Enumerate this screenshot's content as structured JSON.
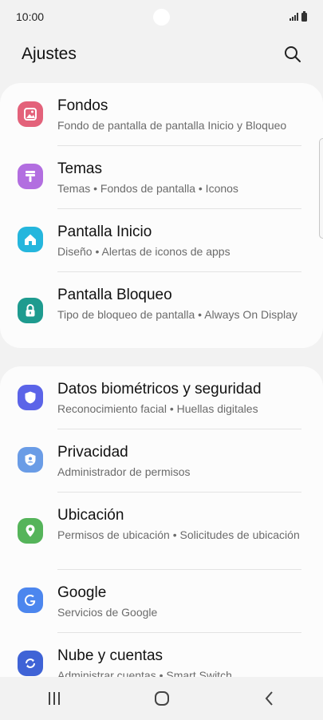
{
  "status_bar": {
    "time": "10:00"
  },
  "header": {
    "title": "Ajustes"
  },
  "group1": [
    {
      "title": "Fondos",
      "subtitle": "Fondo de pantalla de pantalla Inicio y Bloqueo",
      "icon": "wallpaper-icon",
      "color": "#e3627a"
    },
    {
      "title": "Temas",
      "subtitle": "Temas  •  Fondos de pantalla  •  Iconos",
      "icon": "themes-brush-icon",
      "color": "#b26ee0"
    },
    {
      "title": "Pantalla Inicio",
      "subtitle": "Diseño  •  Alertas de iconos de apps",
      "icon": "home-icon",
      "color": "#25b6dd"
    },
    {
      "title": "Pantalla Bloqueo",
      "subtitle": "Tipo de bloqueo de pantalla  •  Always On Display",
      "icon": "lock-icon",
      "color": "#1e9b8f"
    }
  ],
  "group2": [
    {
      "title": "Datos biométricos y seguridad",
      "subtitle": "Reconocimiento facial  •  Huellas digitales",
      "icon": "shield-icon",
      "color": "#5b64e8"
    },
    {
      "title": "Privacidad",
      "subtitle": "Administrador de permisos",
      "icon": "privacy-shield-icon",
      "color": "#6a9ce6"
    },
    {
      "title": "Ubicación",
      "subtitle": "Permisos de ubicación  •  Solicitudes de ubicación",
      "icon": "location-pin-icon",
      "color": "#55b45a"
    },
    {
      "title": "Google",
      "subtitle": "Servicios de Google",
      "icon": "google-icon",
      "color": "#4c86ee"
    },
    {
      "title": "Nube y cuentas",
      "subtitle": "Administrar cuentas  •  Smart Switch",
      "icon": "cloud-sync-icon",
      "color": "#3f63d6"
    }
  ],
  "nav": {
    "recents": "recents-icon",
    "home": "home-button-icon",
    "back": "back-icon"
  }
}
